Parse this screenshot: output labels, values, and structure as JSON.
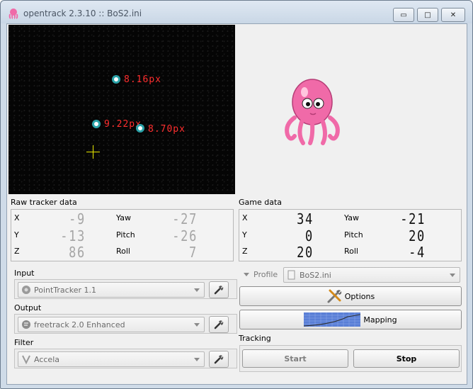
{
  "window": {
    "title": "opentrack 2.3.10 :: BoS2.ini",
    "buttons": {
      "minimize": "▭",
      "maximize": "□",
      "close": "✕"
    }
  },
  "video": {
    "markers": [
      {
        "label": "8.16px"
      },
      {
        "label": "9.22px"
      },
      {
        "label": "8.70px"
      }
    ]
  },
  "raw_tracker": {
    "title": "Raw tracker data",
    "rows": [
      {
        "axis": "X",
        "value": "-9",
        "axis2": "Yaw",
        "value2": "-27"
      },
      {
        "axis": "Y",
        "value": "-13",
        "axis2": "Pitch",
        "value2": "-26"
      },
      {
        "axis": "Z",
        "value": "86",
        "axis2": "Roll",
        "value2": "7"
      }
    ]
  },
  "game_data": {
    "title": "Game data",
    "rows": [
      {
        "axis": "X",
        "value": "34",
        "axis2": "Yaw",
        "value2": "-21"
      },
      {
        "axis": "Y",
        "value": "0",
        "axis2": "Pitch",
        "value2": "20"
      },
      {
        "axis": "Z",
        "value": "20",
        "axis2": "Roll",
        "value2": "-4"
      }
    ]
  },
  "input": {
    "label": "Input",
    "value": "PointTracker 1.1",
    "icon": "pointtracker-icon"
  },
  "output": {
    "label": "Output",
    "value": "freetrack 2.0 Enhanced",
    "icon": "freetrack-icon"
  },
  "filter": {
    "label": "Filter",
    "value": "Accela",
    "icon": "accela-icon"
  },
  "profile": {
    "label": "Profile",
    "value": "BoS2.ini"
  },
  "buttons": {
    "options": "Options",
    "mapping": "Mapping"
  },
  "tracking": {
    "label": "Tracking",
    "start": "Start",
    "stop": "Stop"
  },
  "colors": {
    "marker_label": "#ff2e2e",
    "marker_ring": "#2aa2a8",
    "crosshair": "#e8e800",
    "octopus": "#f06aa8"
  }
}
